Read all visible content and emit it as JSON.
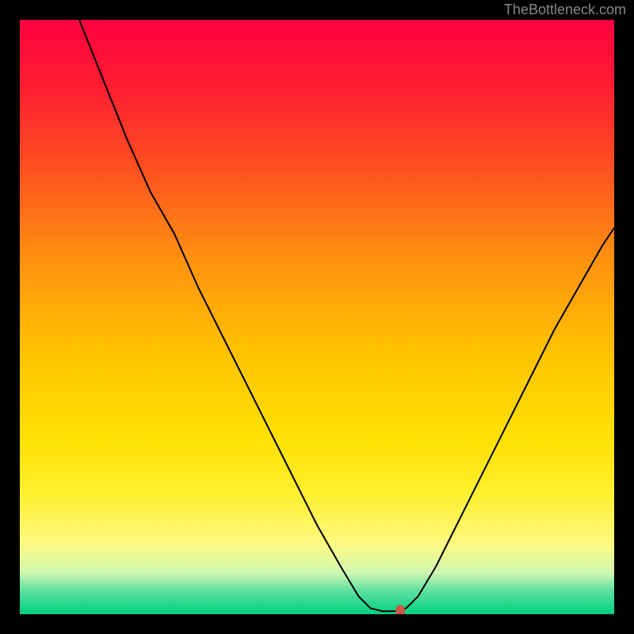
{
  "watermark": "TheBottleneck.com",
  "chart_data": {
    "type": "line",
    "title": "",
    "xlabel": "",
    "ylabel": "",
    "xlim": [
      0,
      100
    ],
    "ylim": [
      0,
      100
    ],
    "background": {
      "type": "vertical_gradient",
      "stops": [
        {
          "offset": 0,
          "color": "#ff0040"
        },
        {
          "offset": 12,
          "color": "#ff2030"
        },
        {
          "offset": 25,
          "color": "#ff5020"
        },
        {
          "offset": 40,
          "color": "#ff9010"
        },
        {
          "offset": 55,
          "color": "#ffc000"
        },
        {
          "offset": 70,
          "color": "#ffe000"
        },
        {
          "offset": 80,
          "color": "#fff030"
        },
        {
          "offset": 88,
          "color": "#fffa80"
        },
        {
          "offset": 93,
          "color": "#d0f8b0"
        },
        {
          "offset": 96,
          "color": "#60e0a0"
        },
        {
          "offset": 100,
          "color": "#00d080"
        }
      ]
    },
    "series": [
      {
        "name": "bottleneck_curve",
        "type": "line",
        "color": "#000000",
        "width": 2,
        "points": [
          {
            "x": 10,
            "y": 100
          },
          {
            "x": 14,
            "y": 90
          },
          {
            "x": 18,
            "y": 80
          },
          {
            "x": 22,
            "y": 71
          },
          {
            "x": 26,
            "y": 64
          },
          {
            "x": 30,
            "y": 55
          },
          {
            "x": 34,
            "y": 47
          },
          {
            "x": 38,
            "y": 39
          },
          {
            "x": 42,
            "y": 31
          },
          {
            "x": 46,
            "y": 23
          },
          {
            "x": 50,
            "y": 15
          },
          {
            "x": 54,
            "y": 8
          },
          {
            "x": 57,
            "y": 3
          },
          {
            "x": 59,
            "y": 1
          },
          {
            "x": 61,
            "y": 0.5
          },
          {
            "x": 63,
            "y": 0.5
          },
          {
            "x": 65,
            "y": 1
          },
          {
            "x": 67,
            "y": 3
          },
          {
            "x": 70,
            "y": 8
          },
          {
            "x": 74,
            "y": 16
          },
          {
            "x": 78,
            "y": 24
          },
          {
            "x": 82,
            "y": 32
          },
          {
            "x": 86,
            "y": 40
          },
          {
            "x": 90,
            "y": 48
          },
          {
            "x": 94,
            "y": 55
          },
          {
            "x": 98,
            "y": 62
          },
          {
            "x": 100,
            "y": 65
          }
        ]
      }
    ],
    "marker": {
      "x": 64,
      "y": 0.5,
      "color": "#cc5544",
      "rx": 6,
      "ry": 8
    },
    "plot_border": {
      "color": "#000000",
      "width": 25
    }
  }
}
